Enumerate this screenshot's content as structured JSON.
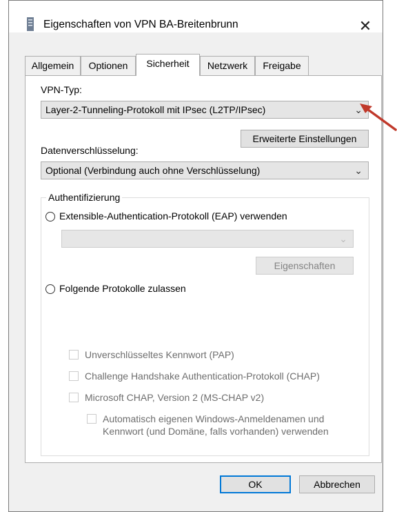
{
  "window": {
    "title": "Eigenschaften von VPN BA-Breitenbrunn",
    "close_icon": "close-icon"
  },
  "tabs": [
    {
      "label": "Allgemein",
      "active": false
    },
    {
      "label": "Optionen",
      "active": false
    },
    {
      "label": "Sicherheit",
      "active": true
    },
    {
      "label": "Netzwerk",
      "active": false
    },
    {
      "label": "Freigabe",
      "active": false
    }
  ],
  "security": {
    "vpn_type_label": "VPN-Typ:",
    "vpn_type_value": "Layer-2-Tunneling-Protokoll mit IPsec (L2TP/IPsec)",
    "advanced_settings_button": "Erweiterte Einstellungen",
    "encryption_label": "Datenverschlüsselung:",
    "encryption_value": "Optional (Verbindung auch ohne Verschlüsselung)",
    "auth_group_label": "Authentifizierung",
    "eap_radio_label": "Extensible-Authentication-Protokoll (EAP) verwenden",
    "eap_combo_value": "",
    "eap_properties_button": "Eigenschaften",
    "protocols_radio_label": "Folgende Protokolle zulassen",
    "checkboxes": [
      {
        "label": "Unverschlüsseltes Kennwort (PAP)",
        "checked": false,
        "enabled": false
      },
      {
        "label": "Challenge Handshake Authentication-Protokoll (CHAP)",
        "checked": false,
        "enabled": false
      },
      {
        "label": "Microsoft CHAP, Version 2 (MS-CHAP v2)",
        "checked": false,
        "enabled": false
      }
    ],
    "auto_logon_label_line1": "Automatisch eigenen Windows-Anmeldenamen und",
    "auto_logon_label_line2": "Kennwort (und Domäne, falls vorhanden) verwenden"
  },
  "footer": {
    "ok_button": "OK",
    "cancel_button": "Abbrechen"
  },
  "annotation": {
    "arrow_color": "#c0392b"
  }
}
